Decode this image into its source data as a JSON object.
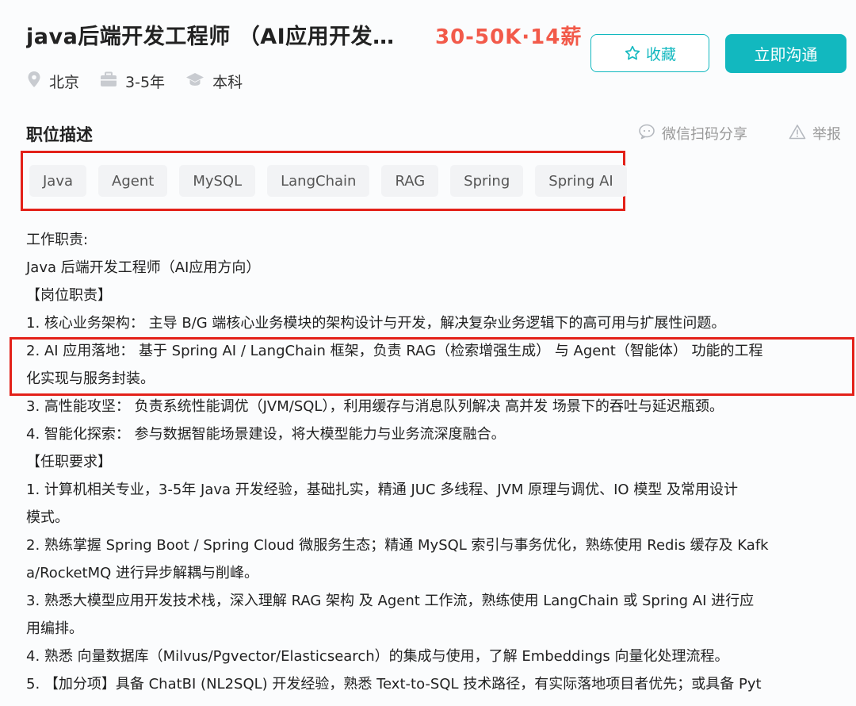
{
  "job": {
    "title": "java后端开发工程师 （AI应用开发…",
    "salary": "30-50K·14薪"
  },
  "actions": {
    "collect_label": "收藏",
    "chat_label": "立即沟通"
  },
  "meta": {
    "city": "北京",
    "experience": "3-5年",
    "education": "本科"
  },
  "section": {
    "title": "职位描述",
    "share_label": "微信扫码分享",
    "report_label": "举报"
  },
  "tags": [
    "Java",
    "Agent",
    "MySQL",
    "LangChain",
    "RAG",
    "Spring",
    "Spring AI"
  ],
  "description": [
    "工作职责:",
    "Java 后端开发工程师（AI应用方向）",
    "【岗位职责】",
    "1. 核心业务架构： 主导 B/G 端核心业务模块的架构设计与开发，解决复杂业务逻辑下的高可用与扩展性问题。",
    "2. AI 应用落地： 基于 Spring AI / LangChain 框架，负责 RAG（检索增强生成） 与 Agent（智能体） 功能的工程",
    "化实现与服务封装。",
    "3. 高性能攻坚： 负责系统性能调优（JVM/SQL），利用缓存与消息队列解决 高并发 场景下的吞吐与延迟瓶颈。",
    "4. 智能化探索： 参与数据智能场景建设，将大模型能力与业务流深度融合。",
    "【任职要求】",
    "1. 计算机相关专业，3-5年 Java 开发经验，基础扎实，精通 JUC 多线程、JVM 原理与调优、IO 模型 及常用设计",
    "模式。",
    "2. 熟练掌握 Spring Boot / Spring Cloud 微服务生态；精通 MySQL 索引与事务优化，熟练使用 Redis 缓存及 Kafk",
    "a/RocketMQ 进行异步解耦与削峰。",
    "3. 熟悉大模型应用开发技术栈，深入理解 RAG 架构 及 Agent 工作流，熟练使用 LangChain 或 Spring AI 进行应",
    "用编排。",
    "4. 熟悉 向量数据库（Milvus/Pgvector/Elasticsearch）的集成与使用，了解 Embeddings 向量化处理流程。",
    "5. 【加分项】具备 ChatBI (NL2SQL) 开发经验，熟悉 Text-to-SQL 技术路径，有实际落地项目者优先；或具备 Pyt"
  ],
  "colors": {
    "accent": "#12b8bf",
    "salary": "#f25a4a",
    "highlight_box": "#e32119"
  },
  "icons": [
    "star-icon",
    "location-icon",
    "briefcase-icon",
    "graduation-cap-icon",
    "wechat-icon",
    "warning-icon"
  ]
}
